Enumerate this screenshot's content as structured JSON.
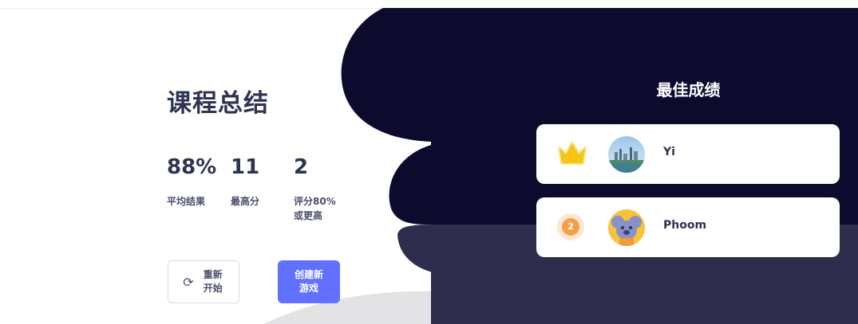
{
  "summary": {
    "title": "课程总结",
    "stats": [
      {
        "value": "88%",
        "label": "平均结果"
      },
      {
        "value": "11",
        "label": "最高分"
      },
      {
        "value": "2",
        "label": "评分80%或更高"
      }
    ],
    "restart_label": "重新开始",
    "create_label": "创建新游戏"
  },
  "leaderboard": {
    "title": "最佳成绩",
    "players": [
      {
        "rank": "1",
        "name": "Yi"
      },
      {
        "rank": "2",
        "name": "Phoom"
      }
    ]
  },
  "colors": {
    "accent": "#6170ff",
    "dark_bg": "#0c0b2e",
    "dark_bg_2": "#2f2d4e",
    "crown": "#f5c518"
  }
}
